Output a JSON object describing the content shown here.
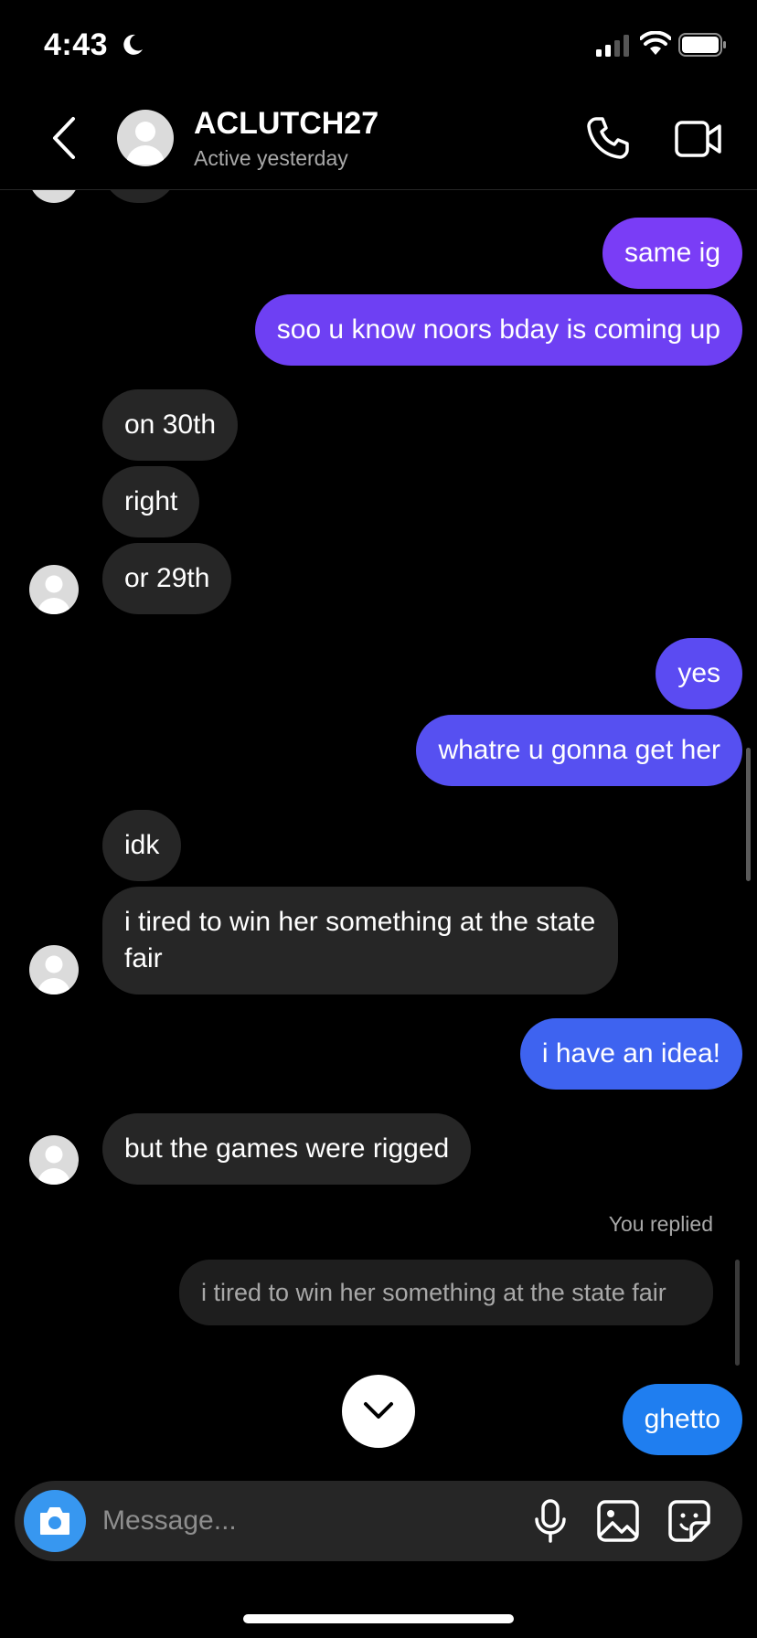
{
  "status": {
    "time": "4:43"
  },
  "header": {
    "title": "ACLUTCH27",
    "subtitle": "Active yesterday"
  },
  "messages": [
    {
      "from": "me",
      "text": "same ig",
      "color": "#7a3df6"
    },
    {
      "from": "me",
      "text": "soo u know noors bday is coming up",
      "color": "#6e40f3"
    },
    {
      "from": "them",
      "text": "on 30th"
    },
    {
      "from": "them",
      "text": "right"
    },
    {
      "from": "them",
      "text": "or 29th"
    },
    {
      "from": "me",
      "text": "yes",
      "color": "#5b4bf2"
    },
    {
      "from": "me",
      "text": "whatre u gonna get her",
      "color": "#5650f1"
    },
    {
      "from": "them",
      "text": "idk"
    },
    {
      "from": "them",
      "text": "i tired to win her something at the state fair"
    },
    {
      "from": "me",
      "text": "i have an idea!",
      "color": "#3e63f0"
    },
    {
      "from": "them",
      "text": "but the games were rigged"
    },
    {
      "from": "me",
      "text": "ghetto",
      "color": "#1f7ef0",
      "reply_label": "You replied",
      "quoted": "i tired to win her something at the state fair"
    }
  ],
  "composer": {
    "placeholder": "Message..."
  },
  "icons": {
    "back": "chevron-left-icon",
    "call": "phone-icon",
    "video": "video-camera-icon",
    "camera": "camera-icon",
    "mic": "microphone-icon",
    "gallery": "image-icon",
    "sticker": "sticker-icon",
    "scroll": "chevron-down-icon"
  }
}
